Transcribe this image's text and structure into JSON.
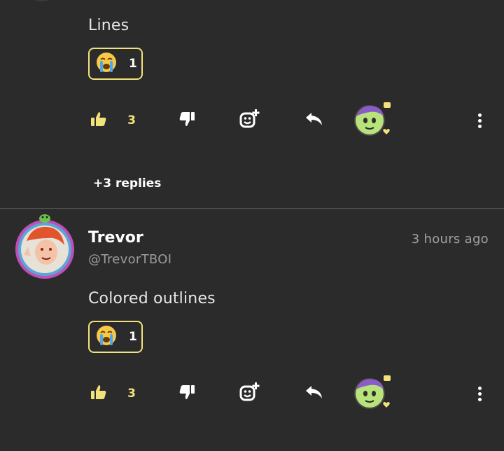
{
  "comment1": {
    "text": "Lines",
    "reaction": {
      "icon": "crying-face-icon",
      "count": "1"
    },
    "likes": "3",
    "replies_label": "+3 replies"
  },
  "comment2": {
    "username": "Trevor",
    "handle": "@TrevorTBOI",
    "timestamp": "3 hours ago",
    "text": "Colored outlines",
    "reaction": {
      "icon": "crying-face-icon",
      "count": "1"
    },
    "likes": "3"
  },
  "colors": {
    "background": "#2b2b2c",
    "accent_yellow": "#f3e27a",
    "divider": "#555556",
    "muted_text": "#a0a0a0"
  },
  "icons": [
    "thumbs-up-icon",
    "thumbs-down-icon",
    "add-reaction-icon",
    "reply-icon",
    "more-icon"
  ]
}
